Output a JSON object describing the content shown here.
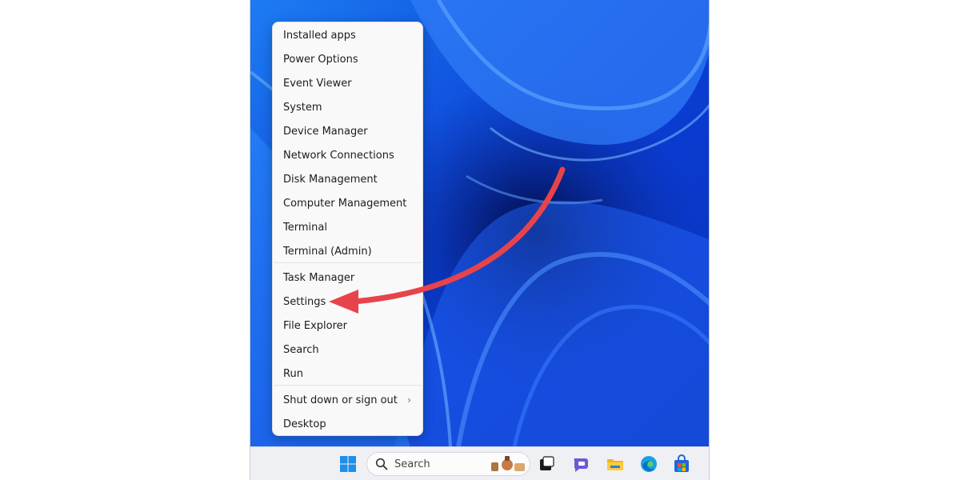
{
  "context_menu": {
    "group1": [
      {
        "label": "Installed apps"
      },
      {
        "label": "Power Options"
      },
      {
        "label": "Event Viewer"
      },
      {
        "label": "System"
      },
      {
        "label": "Device Manager"
      },
      {
        "label": "Network Connections"
      },
      {
        "label": "Disk Management"
      },
      {
        "label": "Computer Management"
      },
      {
        "label": "Terminal"
      },
      {
        "label": "Terminal (Admin)"
      }
    ],
    "group2": [
      {
        "label": "Task Manager"
      },
      {
        "label": "Settings"
      },
      {
        "label": "File Explorer"
      },
      {
        "label": "Search"
      },
      {
        "label": "Run"
      }
    ],
    "group3": [
      {
        "label": "Shut down or sign out",
        "submenu": true
      },
      {
        "label": "Desktop"
      }
    ]
  },
  "annotation": {
    "arrow_color": "#e8434a",
    "points_to": "Settings"
  },
  "taskbar": {
    "search_label": "Search",
    "icons": [
      "windows-start-icon",
      "search-icon",
      "search-highlight-icon",
      "task-view-icon",
      "teams-chat-icon",
      "file-explorer-icon",
      "edge-icon",
      "store-icon"
    ]
  },
  "colors": {
    "wallpaper_base": "#0a3fd6",
    "menu_bg": "#f9f9f9",
    "taskbar_bg": "#eef0f4"
  }
}
